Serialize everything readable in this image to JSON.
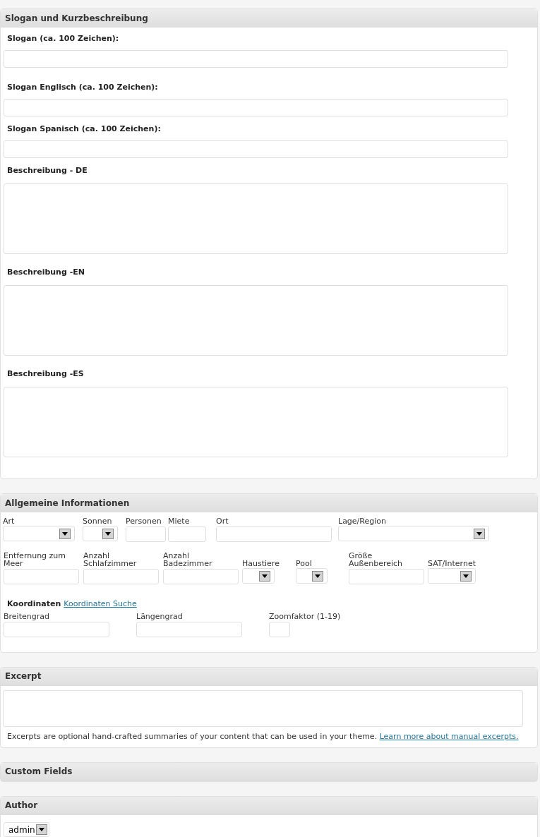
{
  "slogan_panel": {
    "title": "Slogan und Kurzbeschreibung",
    "fields": [
      {
        "label": "Slogan (ca. 100 Zeichen):",
        "kind": "input"
      },
      {
        "label": "Slogan Englisch (ca. 100 Zeichen):",
        "kind": "input"
      },
      {
        "label": "Slogan Spanisch (ca. 100 Zeichen):",
        "kind": "input"
      },
      {
        "label": "Beschreibung - DE",
        "kind": "textarea"
      },
      {
        "label": "Beschreibung -EN",
        "kind": "textarea"
      },
      {
        "label": "Beschreibung -ES",
        "kind": "textarea"
      }
    ]
  },
  "info_panel": {
    "title": "Allgemeine Informationen",
    "row_1": [
      {
        "label": "Art",
        "kind": "select"
      },
      {
        "label": "Sonnen",
        "kind": "select"
      },
      {
        "label": "Personen",
        "kind": "input"
      },
      {
        "label": "Miete",
        "kind": "input"
      },
      {
        "label": "Ort",
        "kind": "input"
      },
      {
        "label": "Lage/Region",
        "kind": "select"
      }
    ],
    "row_2": [
      {
        "label": "Entfernung zum Meer",
        "kind": "input"
      },
      {
        "label": "Anzahl Schlafzimmer",
        "kind": "input"
      },
      {
        "label": "Anzahl Badezimmer",
        "kind": "input"
      },
      {
        "label": "Haustiere",
        "kind": "select"
      },
      {
        "label": "Pool",
        "kind": "select"
      },
      {
        "label": "Größe Außenbereich",
        "kind": "input"
      },
      {
        "label": "SAT/Internet",
        "kind": "select"
      }
    ],
    "coordinates": {
      "heading": "Koordinaten",
      "link": "Koordinaten Suche"
    },
    "row_3": [
      {
        "label": "Breitengrad",
        "kind": "input"
      },
      {
        "label": "Längengrad",
        "kind": "input"
      },
      {
        "label": "Zoomfaktor (1-19)",
        "kind": "input"
      }
    ]
  },
  "excerpt_panel": {
    "title": "Excerpt",
    "help": "Excerpts are optional hand-crafted summaries of your content that can be used in your theme.",
    "link": "Learn more about manual excerpts."
  },
  "custom_fields_panel": {
    "title": "Custom Fields"
  },
  "author_panel": {
    "title": "Author",
    "value": "admin"
  }
}
